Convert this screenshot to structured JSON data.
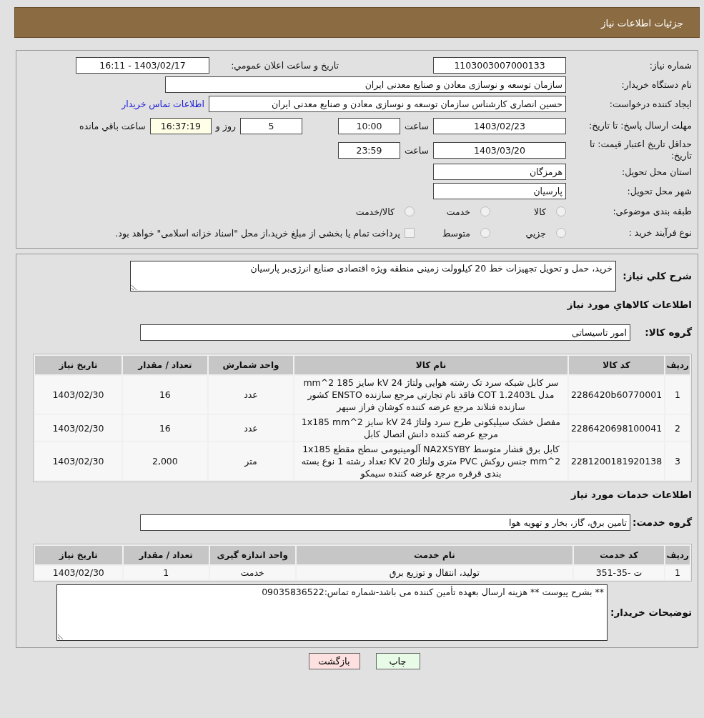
{
  "header": {
    "title": "جزئیات اطلاعات نیاز"
  },
  "need_number": {
    "label": "شماره نیاز:",
    "value": "1103003007000133"
  },
  "announce": {
    "label": "تاریخ و ساعت اعلان عمومي:",
    "value": "1403/02/17 - 16:11"
  },
  "buyer_org": {
    "label": "نام دستگاه خریدار:",
    "value": "سازمان توسعه و نوسازی معادن و صنایع معدنی ایران"
  },
  "requester": {
    "label": "ایجاد کننده درخواست:",
    "value": "حسین انصاری کارشناس سازمان توسعه و نوسازی معادن و صنایع معدنی ایران",
    "link": "اطلاعات تماس خریدار"
  },
  "deadline": {
    "label": "مهلت ارسال پاسخ: تا تاریخ:",
    "date": "1403/02/23",
    "time_label": "ساعت",
    "time": "10:00",
    "days": "5",
    "days_label": "روز و",
    "remaining": "16:37:19",
    "remaining_label": "ساعت باقي مانده"
  },
  "validity": {
    "label": "حداقل تاریخ اعتبار قیمت: تا تاریخ:",
    "date": "1403/03/20",
    "time_label": "ساعت",
    "time": "23:59"
  },
  "province": {
    "label": "استان محل تحویل:",
    "value": "هرمزگان"
  },
  "city": {
    "label": "شهر محل تحویل:",
    "value": "پارسیان"
  },
  "category": {
    "label": "طبقه بندی موضوعی:",
    "options": [
      {
        "label": "کالا",
        "selected": false
      },
      {
        "label": "خدمت",
        "selected": false
      },
      {
        "label": "کالا/خدمت",
        "selected": false
      }
    ]
  },
  "process": {
    "label": "نوع فرآیند خرید :",
    "options": [
      {
        "label": "جزيي",
        "selected": false
      },
      {
        "label": "متوسط",
        "selected": false
      }
    ],
    "payment_note": {
      "label": "پرداخت تمام یا بخشی از مبلغ خرید،از محل \"اسناد خزانه اسلامی\" خواهد بود.",
      "checked": false
    }
  },
  "summary": {
    "label": "شرح کلي نیاز:",
    "value": "خرید، حمل و تحویل تجهیزات خط 20 کیلوولت زمینی منطقه ویژه اقتصادی صنایع انرژی‌بر پارسیان"
  },
  "goods": {
    "title": "اطلاعات کالاهاي مورد نیاز",
    "group_label": "گروه کالا:",
    "group_value": "امور تاسیساتی",
    "columns": [
      "ردیف",
      "کد کالا",
      "نام کالا",
      "واحد شمارش",
      "تعداد / مقدار",
      "تاریخ نیاز"
    ],
    "rows": [
      [
        "1",
        "2286420b60770001",
        "سر کابل شبکه سرد تک رشته هوایی ولتاژ 24 kV سایز 185 mm^2 مدل COT 1.2403L فاقد نام تجارتی مرجع سازنده ENSTO کشور سازنده فنلاند مرجع عرضه کننده کوشان فراز سپهر",
        "عدد",
        "16",
        "1403/02/30"
      ],
      [
        "2",
        "2286420698100041",
        "مفصل خشک سیلیکونی طرح سرد ولتاژ 24 kV سایز 1x185 mm^2 مرجع عرضه کننده دانش اتصال کابل",
        "عدد",
        "16",
        "1403/02/30"
      ],
      [
        "3",
        "2281200181920138",
        "کابل برق فشار متوسط NA2XSYBY آلومینیومی سطح مقطع 1x185 mm^2 جنس روکش PVC متری ولتاژ KV 20 تعداد رشته 1 نوع بسته بندی قرقره مرجع عرضه کننده سیمکو",
        "متر",
        "2,000",
        "1403/02/30"
      ]
    ]
  },
  "services": {
    "title": "اطلاعات خدمات مورد نیاز",
    "group_label": "گروه خدمت:",
    "group_value": "تامین برق، گاز، بخار و تهویه هوا",
    "columns": [
      "ردیف",
      "کد خدمت",
      "نام خدمت",
      "واحد اندازه گیری",
      "تعداد / مقدار",
      "تاریخ نیاز"
    ],
    "rows": [
      [
        "1",
        "ت -35-351",
        "تولید، انتقال و توزیع برق",
        "خدمت",
        "1",
        "1403/02/30"
      ]
    ]
  },
  "buyer_notes": {
    "label": "توضیحات خریدار:",
    "value": "** بشرح پیوست ** هزینه ارسال بعهده تأمین کننده می باشد-شماره تماس:09035836522"
  },
  "buttons": [
    {
      "label": "چاپ",
      "kind": "print"
    },
    {
      "label": "بازگشت",
      "kind": "back"
    }
  ]
}
